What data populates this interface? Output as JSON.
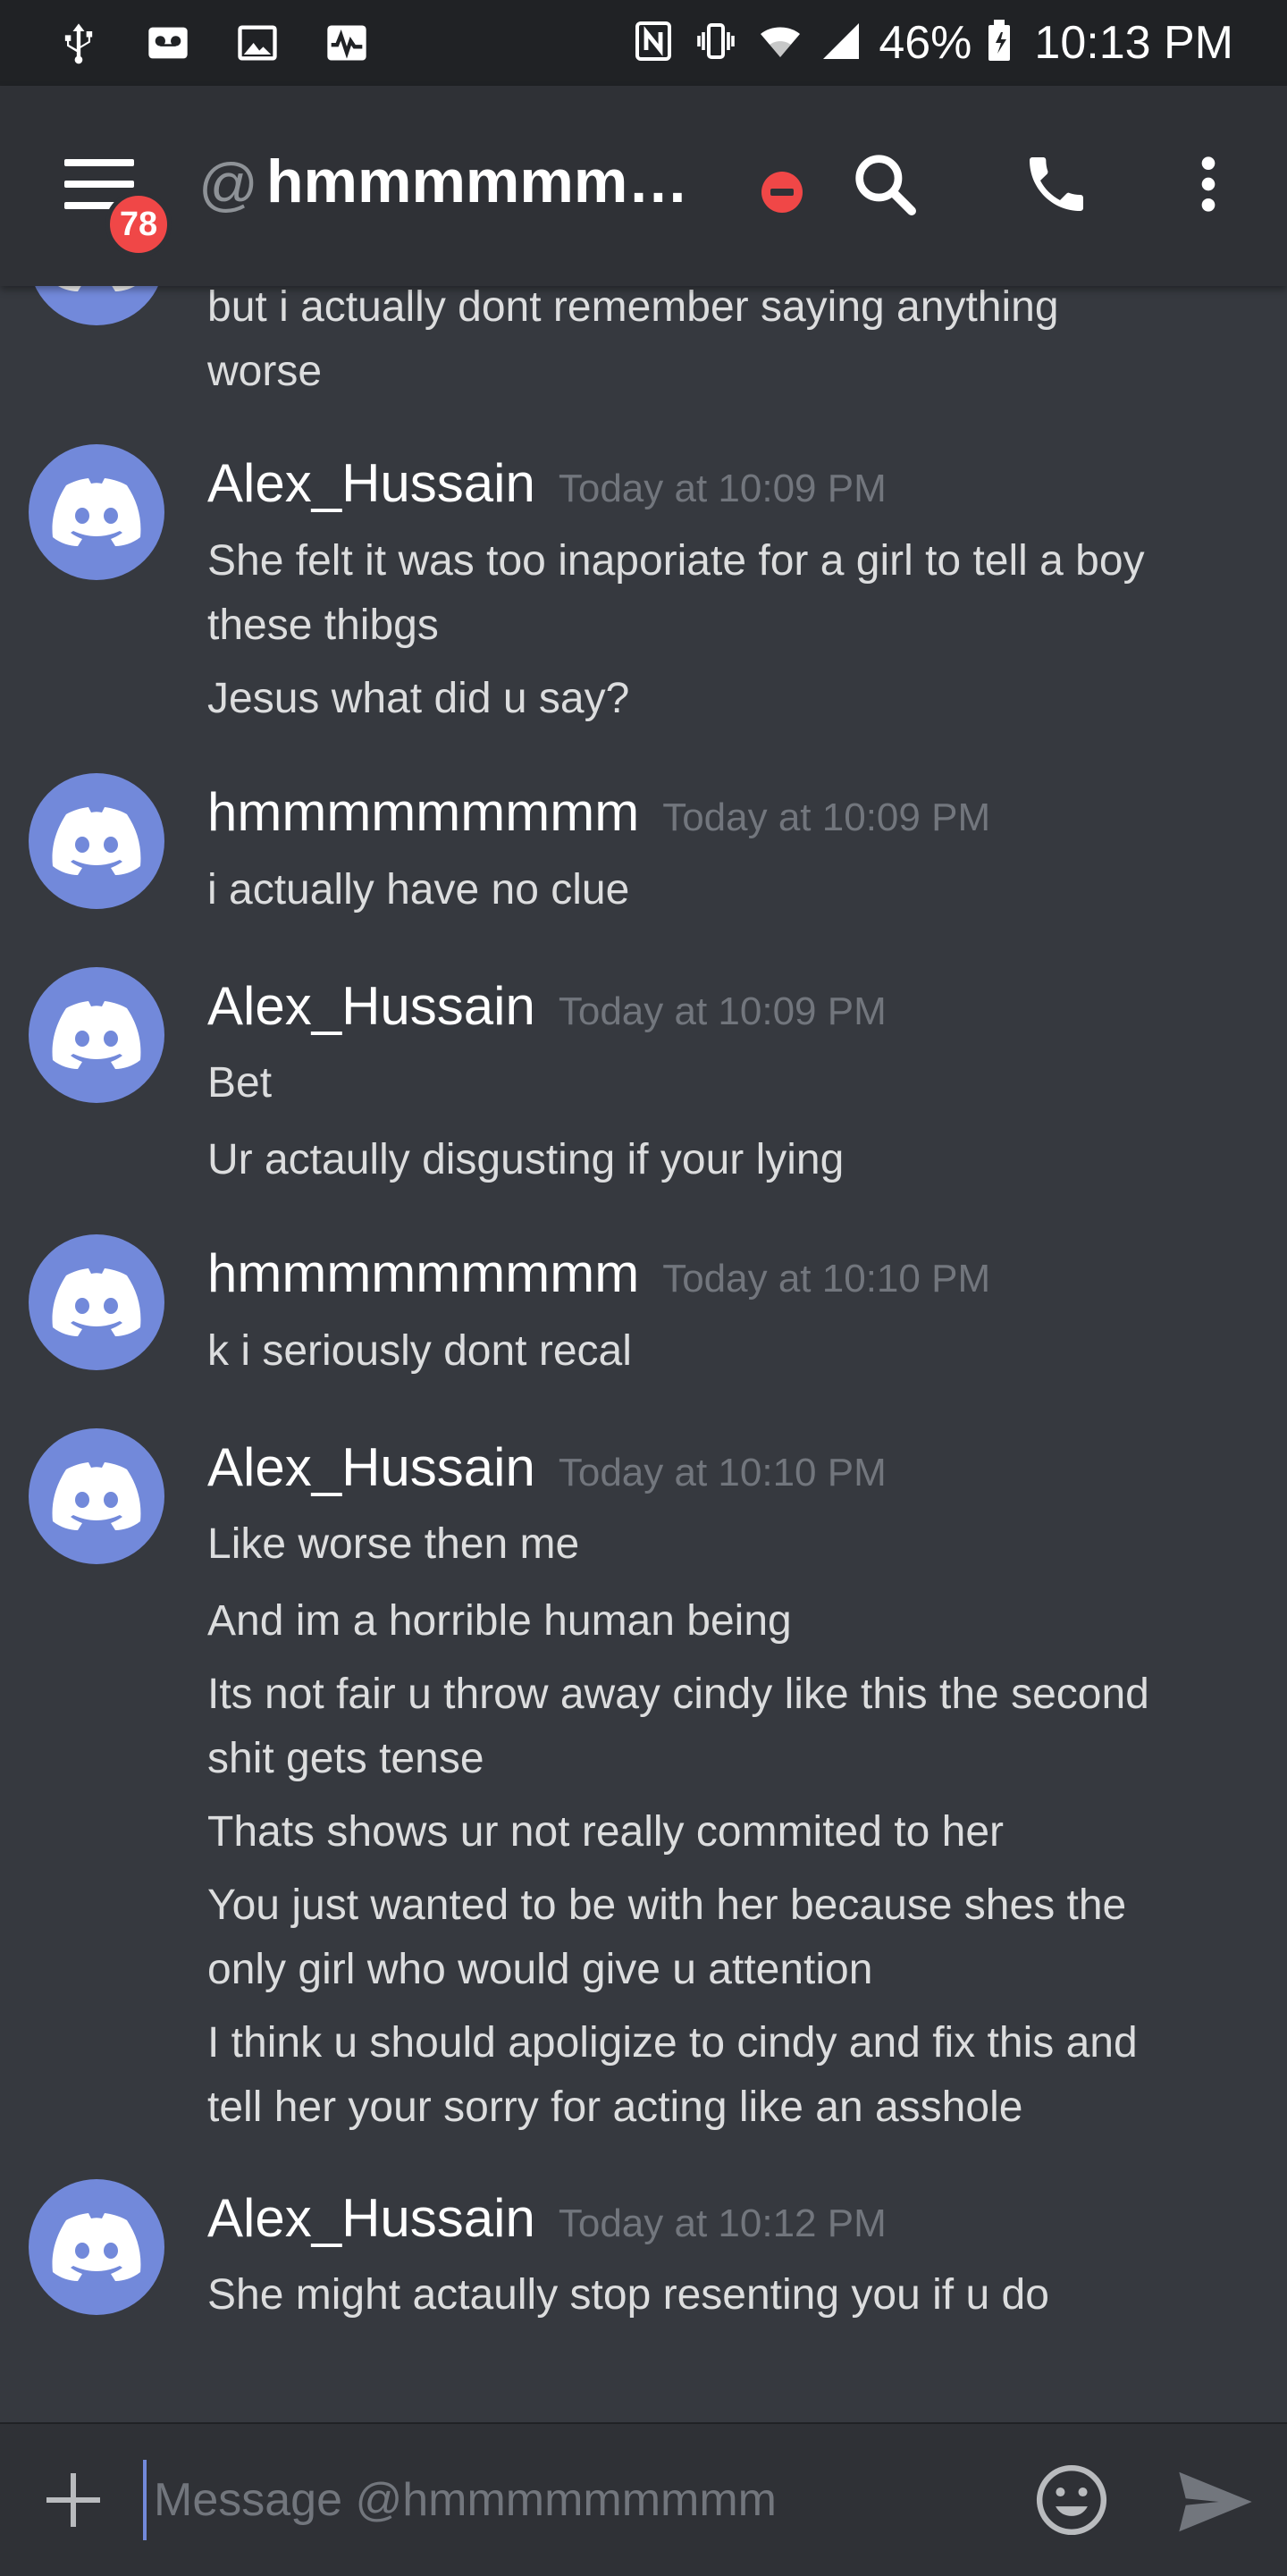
{
  "status_bar": {
    "battery_percent": "46%",
    "time": "10:13 PM"
  },
  "header": {
    "at_symbol": "@",
    "channel_name": "hmmmmmmmmm...",
    "notification_badge": "78"
  },
  "messages": {
    "partial": {
      "lines": [
        "but i actually dont remember saying anything",
        "worse"
      ]
    },
    "g1": {
      "author": "Alex_Hussain",
      "timestamp": "Today at 10:09 PM",
      "lines": [
        "She felt it was too inaporiate for a girl to tell a boy",
        "these thibgs",
        "Jesus what did u say?"
      ]
    },
    "g2": {
      "author": "hmmmmmmmmm",
      "timestamp": "Today at 10:09 PM",
      "lines": [
        "i actually have no clue"
      ]
    },
    "g3": {
      "author": "Alex_Hussain",
      "timestamp": "Today at 10:09 PM",
      "lines": [
        "Bet",
        "Ur actaully disgusting if your lying"
      ]
    },
    "g4": {
      "author": "hmmmmmmmmm",
      "timestamp": "Today at 10:10 PM",
      "lines": [
        "k i seriously dont recal"
      ]
    },
    "g5": {
      "author": "Alex_Hussain",
      "timestamp": "Today at 10:10 PM",
      "lines": [
        "Like worse then me",
        "And im a horrible human being",
        "Its not fair u throw away cindy like this the second",
        "shit gets tense",
        "Thats shows ur not really commited to her",
        "You just wanted to be with her because shes the",
        "only girl who would give u attention",
        "I think u should apoligize to cindy and fix this and",
        "tell her your sorry for acting like an asshole"
      ]
    },
    "g6": {
      "author": "Alex_Hussain",
      "timestamp": "Today at 10:12 PM",
      "lines": [
        "She might actaully stop resenting you if u do"
      ]
    }
  },
  "composer": {
    "placeholder": "Message @hmmmmmmmmm"
  },
  "colors": {
    "background": "#36393f",
    "header_bg": "#2f3136",
    "status_bar_bg": "#202225",
    "avatar_blurple": "#7289da",
    "dnd_red": "#f04747",
    "timestamp_gray": "#72767d"
  },
  "icons": [
    "usb-icon",
    "voicemail-icon",
    "image-icon",
    "activity-icon",
    "nfc-icon",
    "vibrate-icon",
    "wifi-icon",
    "signal-icon",
    "battery-icon",
    "menu-icon",
    "search-icon",
    "phone-icon",
    "more-vertical-icon",
    "plus-icon",
    "emoji-icon",
    "send-icon",
    "discord-avatar-icon"
  ]
}
